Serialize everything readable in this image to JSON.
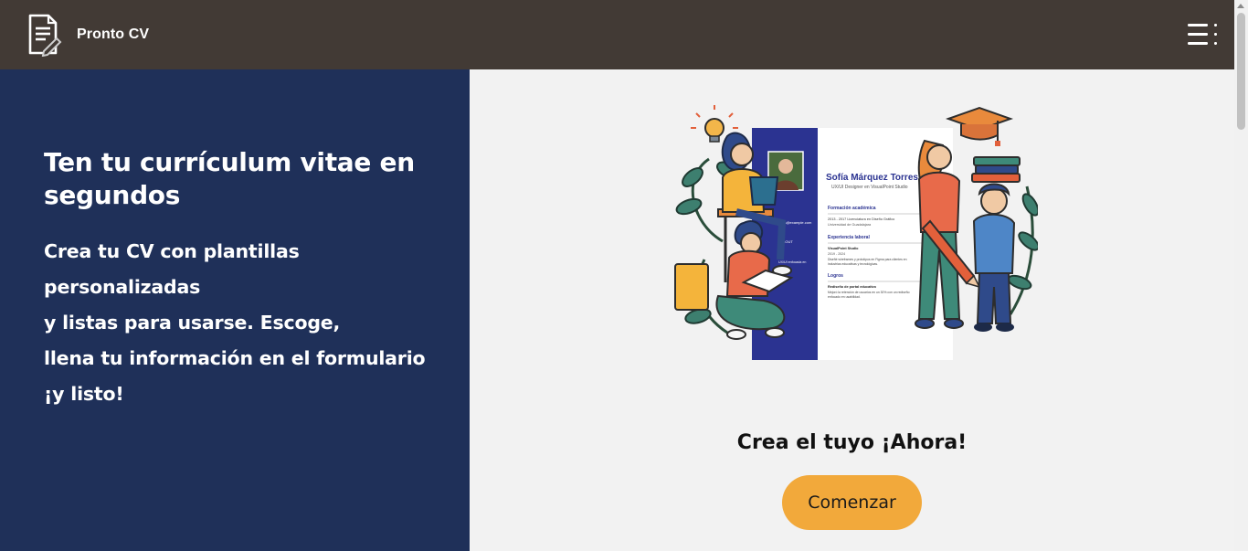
{
  "navbar": {
    "brand": "Pronto CV",
    "logo_icon": "document-pencil-icon",
    "menu_icon": "hamburger-menu-icon"
  },
  "hero": {
    "headline": "Ten tu currículum vitae en segundos",
    "subline_lines": [
      "Crea tu CV con plantillas",
      "personalizadas",
      "y listas para usarse. Escoge,",
      "llena tu información en el formulario",
      "¡y listo!"
    ]
  },
  "illustration": {
    "cv_name": "Sofía Márquez Torres",
    "cv_role": "UX/UI Designer en VisualPoint Studio",
    "sections": {
      "education": "Formación académica",
      "education_line1": "2013 - 2017   Licenciatura en Diseño Gráfico",
      "education_line2": "Universidad de Guadalajara",
      "experience": "Experiencia laboral",
      "experience_company": "VisualPoint Studio",
      "experience_years": "2019 - 2024",
      "experience_desc1": "Diseñé wireframes y prototipos en Figma para clientes en",
      "experience_desc2": "industrias educativas y tecnológicas.",
      "achievements": "Logros",
      "achievement_title": "Rediseño de portal educativo",
      "achievement_desc1": "Mejoró la retención de usuarios en un 30% con un rediseño",
      "achievement_desc2": "enfocado en usabilidad."
    },
    "sidebar_email": "sofia@example.com",
    "sidebar_about": "UX/UI enfocada en"
  },
  "cta": {
    "text": "Crea el tuyo ¡Ahora!",
    "button_label": "Comenzar"
  },
  "colors": {
    "navbar": "#423a35",
    "left_panel": "#1f3059",
    "right_panel": "#f2f2f2",
    "button": "#f2a93b",
    "cv_sidebar": "#2b3391"
  }
}
